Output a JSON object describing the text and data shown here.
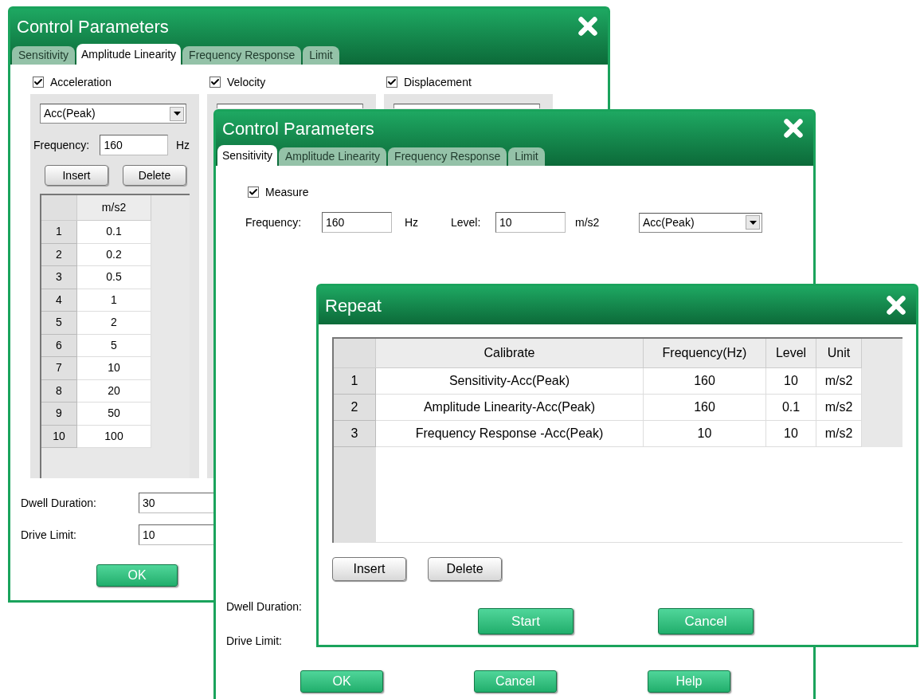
{
  "back_window": {
    "title": "Control Parameters",
    "tabs": [
      {
        "label": "Sensitivity",
        "selected": false
      },
      {
        "label": "Amplitude Linearity",
        "selected": true
      },
      {
        "label": "Frequency Response",
        "selected": false
      },
      {
        "label": "Limit",
        "selected": false
      }
    ],
    "groups": [
      {
        "label": "Acceleration",
        "checked": true,
        "dropdown": "Acc(Peak)",
        "frequency_label": "Frequency:",
        "frequency_value": "160",
        "frequency_unit": "Hz",
        "buttons": [
          "Insert",
          "Delete"
        ],
        "column": "m/s2",
        "rows": [
          {
            "index": "1",
            "value": "0.1"
          },
          {
            "index": "2",
            "value": "0.2"
          },
          {
            "index": "3",
            "value": "0.5"
          },
          {
            "index": "4",
            "value": "1"
          },
          {
            "index": "5",
            "value": "2"
          },
          {
            "index": "6",
            "value": "5"
          },
          {
            "index": "7",
            "value": "10"
          },
          {
            "index": "8",
            "value": "20"
          },
          {
            "index": "9",
            "value": "50"
          },
          {
            "index": "10",
            "value": "100"
          }
        ]
      },
      {
        "label": "Velocity",
        "checked": true
      },
      {
        "label": "Displacement",
        "checked": true
      }
    ],
    "fields": [
      {
        "label": "Dwell Duration:",
        "value": "30"
      },
      {
        "label": "Drive Limit:",
        "value": "10"
      }
    ],
    "buttons": [
      "OK"
    ]
  },
  "middle_window": {
    "title": "Control Parameters",
    "tabs": [
      {
        "label": "Sensitivity",
        "selected": true
      },
      {
        "label": "Amplitude Linearity",
        "selected": false
      },
      {
        "label": "Frequency Response",
        "selected": false
      },
      {
        "label": "Limit",
        "selected": false
      }
    ],
    "measure": {
      "label": "Measure",
      "checked": true
    },
    "frequency": {
      "label": "Frequency:",
      "value": "160",
      "unit": "Hz"
    },
    "level": {
      "label": "Level:",
      "value": "10",
      "unit": "m/s2"
    },
    "dropdown": "Acc(Peak)",
    "field_labels": [
      "Dwell Duration:",
      "Drive Limit:"
    ],
    "buttons": [
      "OK",
      "Cancel",
      "Help"
    ]
  },
  "repeat_dialog": {
    "title": "Repeat",
    "columns": [
      "Calibrate",
      "Frequency(Hz)",
      "Level",
      "Unit"
    ],
    "rows": [
      {
        "index": "1",
        "cells": [
          "Sensitivity-Acc(Peak)",
          "160",
          "10",
          "m/s2"
        ]
      },
      {
        "index": "2",
        "cells": [
          "Amplitude Linearity-Acc(Peak)",
          "160",
          "0.1",
          "m/s2"
        ]
      },
      {
        "index": "3",
        "cells": [
          "Frequency Response -Acc(Peak)",
          "10",
          "10",
          "m/s2"
        ]
      }
    ],
    "table_buttons": [
      "Insert",
      "Delete"
    ],
    "buttons": [
      "Start",
      "Cancel"
    ]
  }
}
